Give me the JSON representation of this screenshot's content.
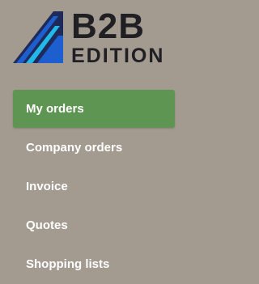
{
  "brand": {
    "logo_main": "B2B",
    "logo_sub": "EDITION"
  },
  "nav": {
    "items": [
      {
        "label": "My orders",
        "active": true
      },
      {
        "label": "Company orders",
        "active": false
      },
      {
        "label": "Invoice",
        "active": false
      },
      {
        "label": "Quotes",
        "active": false
      },
      {
        "label": "Shopping lists",
        "active": false
      }
    ]
  },
  "colors": {
    "background": "#a39a90",
    "active_item": "#5f9553",
    "logo_dark": "#1f1f24",
    "logo_accent_blue": "#1e5fd0",
    "logo_accent_cyan": "#22b8e8"
  }
}
